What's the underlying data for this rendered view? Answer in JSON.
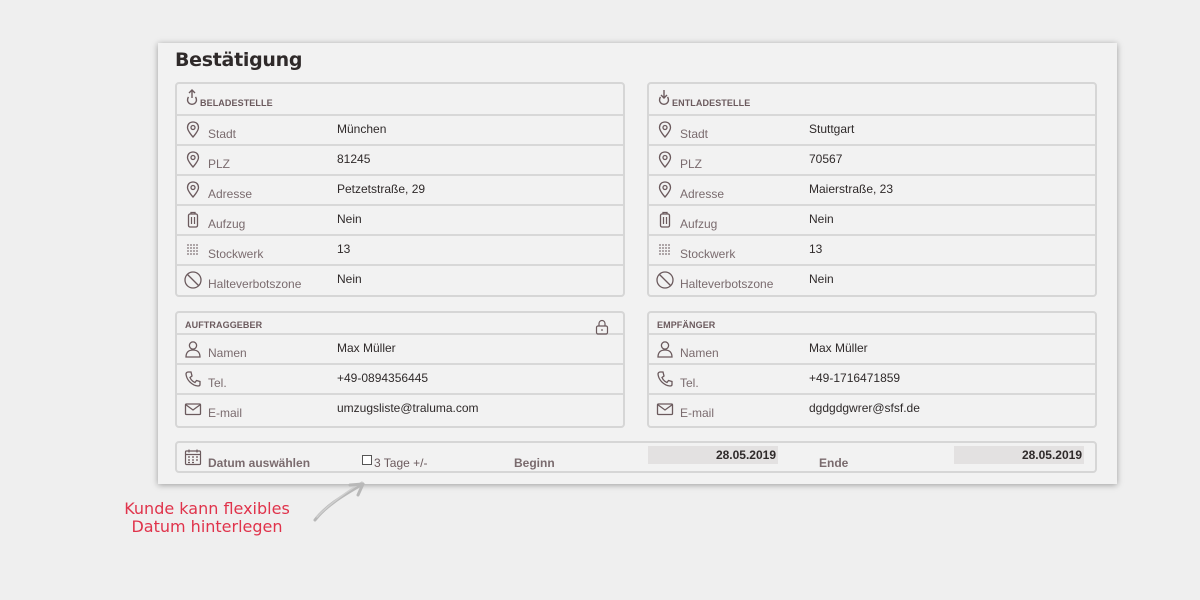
{
  "title": "Bestätigung",
  "pickup": {
    "header": "BELADESTELLE",
    "header_icon": "pickup-pin-icon",
    "rows": [
      {
        "label": "Stadt",
        "value": "München",
        "icon": "location-pin-icon"
      },
      {
        "label": "PLZ",
        "value": "81245",
        "icon": "location-pin-icon"
      },
      {
        "label": "Adresse",
        "value": "Petzetstraße, 29",
        "icon": "location-pin-icon"
      },
      {
        "label": "Aufzug",
        "value": "Nein",
        "icon": "elevator-icon"
      },
      {
        "label": "Stockwerk",
        "value": "13",
        "icon": "floors-icon"
      },
      {
        "label": "Halteverbotszone",
        "value": "Nein",
        "icon": "no-parking-icon"
      }
    ]
  },
  "dropoff": {
    "header": "ENTLADESTELLE",
    "header_icon": "dropoff-pin-icon",
    "rows": [
      {
        "label": "Stadt",
        "value": "Stuttgart",
        "icon": "location-pin-icon"
      },
      {
        "label": "PLZ",
        "value": "70567",
        "icon": "location-pin-icon"
      },
      {
        "label": "Adresse",
        "value": "Maierstraße, 23",
        "icon": "location-pin-icon"
      },
      {
        "label": "Aufzug",
        "value": "Nein",
        "icon": "elevator-icon"
      },
      {
        "label": "Stockwerk",
        "value": "13",
        "icon": "floors-icon"
      },
      {
        "label": "Halteverbotszone",
        "value": "Nein",
        "icon": "no-parking-icon"
      }
    ]
  },
  "client": {
    "header": "AUFTRAGGEBER",
    "rows": [
      {
        "label": "Namen",
        "value": "Max Müller",
        "icon": "person-icon"
      },
      {
        "label": "Tel.",
        "value": "+49-0894356445",
        "icon": "phone-icon"
      },
      {
        "label": "E-mail",
        "value": "umzugsliste@traluma.com",
        "icon": "mail-icon"
      }
    ]
  },
  "recipient": {
    "header": "EMPFÄNGER",
    "rows": [
      {
        "label": "Namen",
        "value": "Max Müller",
        "icon": "person-icon"
      },
      {
        "label": "Tel.",
        "value": "+49-1716471859",
        "icon": "phone-icon"
      },
      {
        "label": "E-mail",
        "value": "dgdgdgwrer@sfsf.de",
        "icon": "mail-icon"
      }
    ]
  },
  "date": {
    "label": "Datum auswählen",
    "flex_label": "3 Tage +/-",
    "flex_checked": false,
    "begin_label": "Beginn",
    "begin_value": "28.05.2019",
    "end_label": "Ende",
    "end_value": "28.05.2019"
  },
  "annotation": {
    "line1": "Kunde kann flexibles",
    "line2": "Datum hinterlegen",
    "color": "#e0334b"
  }
}
